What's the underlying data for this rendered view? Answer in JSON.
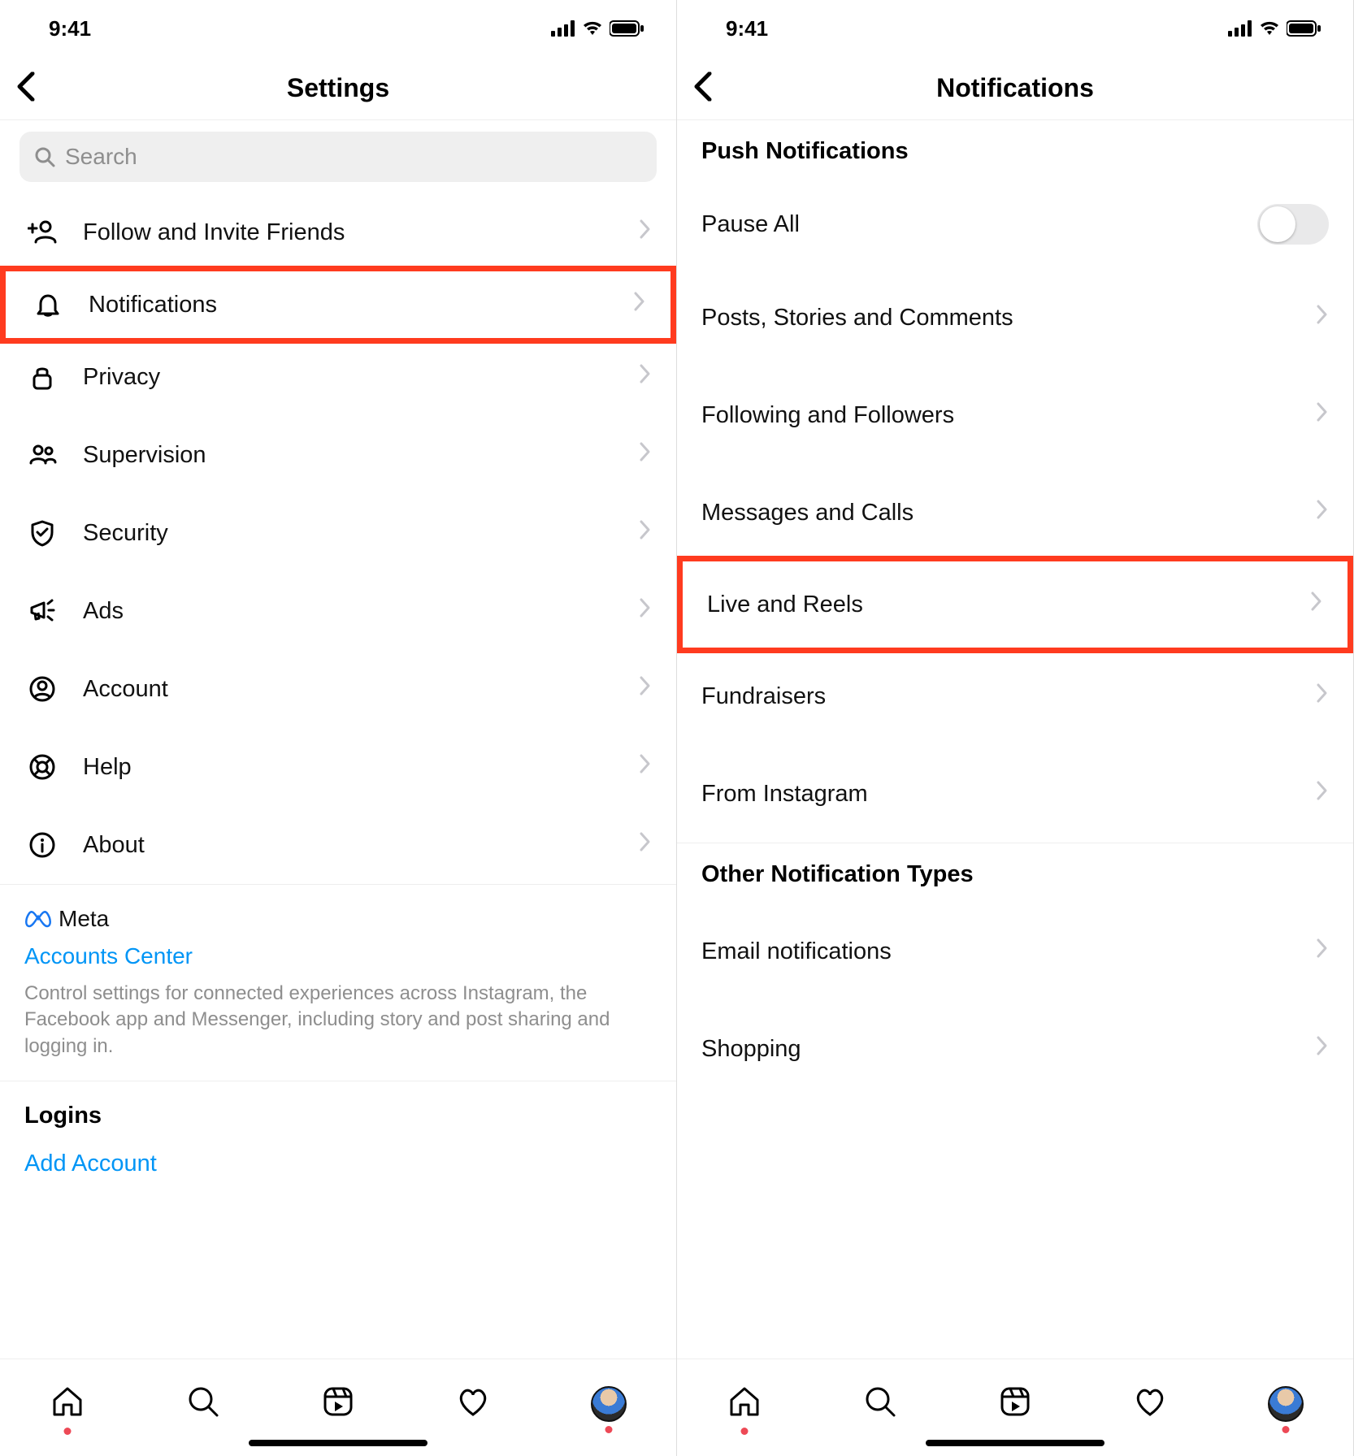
{
  "status": {
    "time": "9:41"
  },
  "left": {
    "title": "Settings",
    "search_placeholder": "Search",
    "items": [
      {
        "label": "Follow and Invite Friends",
        "icon": "person-add"
      },
      {
        "label": "Notifications",
        "icon": "bell",
        "highlighted": true
      },
      {
        "label": "Privacy",
        "icon": "lock"
      },
      {
        "label": "Supervision",
        "icon": "people"
      },
      {
        "label": "Security",
        "icon": "shield"
      },
      {
        "label": "Ads",
        "icon": "megaphone"
      },
      {
        "label": "Account",
        "icon": "user-circle"
      },
      {
        "label": "Help",
        "icon": "lifebuoy"
      },
      {
        "label": "About",
        "icon": "info"
      }
    ],
    "meta_label": "Meta",
    "accounts_center": "Accounts Center",
    "meta_desc": "Control settings for connected experiences across Instagram, the Facebook app and Messenger, including story and post sharing and logging in.",
    "logins_title": "Logins",
    "add_account": "Add Account"
  },
  "right": {
    "title": "Notifications",
    "section_push": "Push Notifications",
    "pause_all": "Pause All",
    "push_items": [
      {
        "label": "Posts, Stories and Comments"
      },
      {
        "label": "Following and Followers"
      },
      {
        "label": "Messages and Calls"
      },
      {
        "label": "Live and Reels",
        "highlighted": true
      },
      {
        "label": "Fundraisers"
      },
      {
        "label": "From Instagram"
      }
    ],
    "section_other": "Other Notification Types",
    "other_items": [
      {
        "label": "Email notifications"
      },
      {
        "label": "Shopping"
      }
    ]
  }
}
